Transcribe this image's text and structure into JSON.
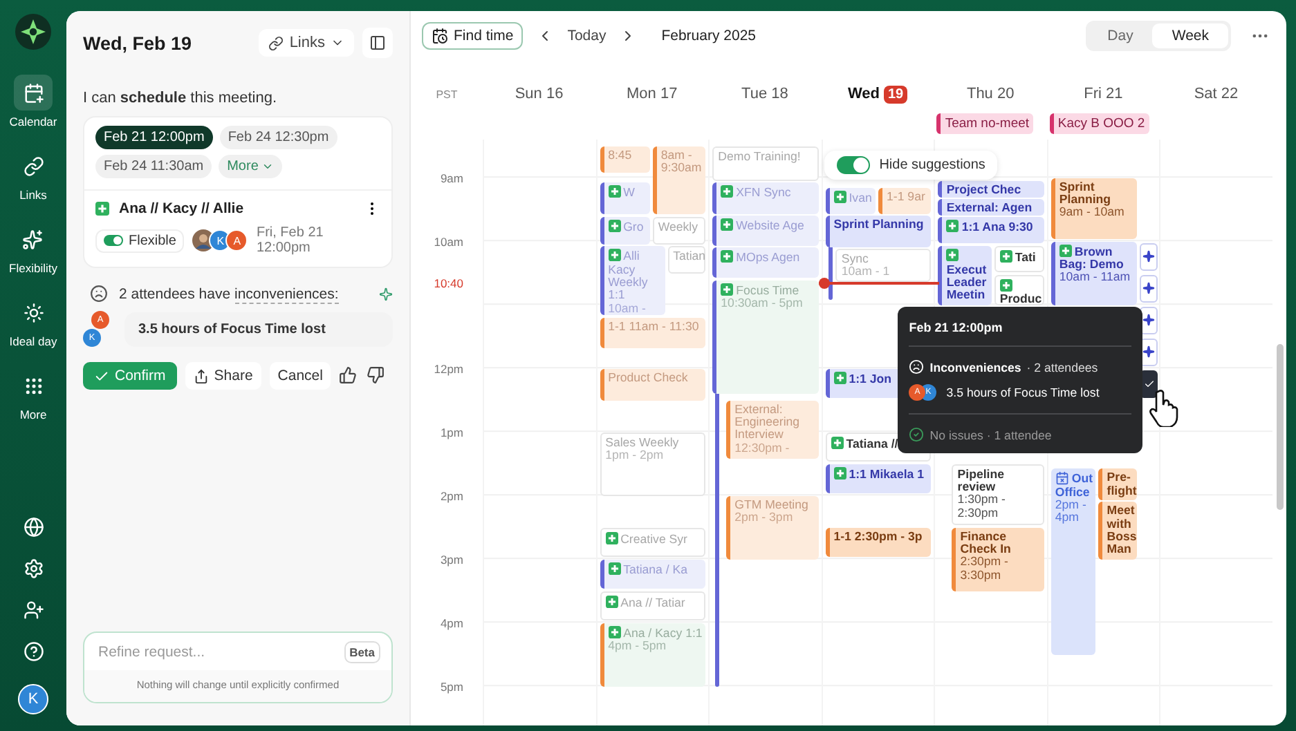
{
  "rail": {
    "items": [
      {
        "label": "Calendar",
        "selected": true
      },
      {
        "label": "Links",
        "selected": false
      },
      {
        "label": "Flexibility",
        "selected": false
      },
      {
        "label": "Ideal day",
        "selected": false
      },
      {
        "label": "More",
        "selected": false
      }
    ],
    "avatar": {
      "initial": "K",
      "color": "#2f86d6"
    }
  },
  "panel": {
    "title": "Wed, Feb 19",
    "links_button": "Links",
    "message": "I can **schedule** this meeting.",
    "slots": [
      {
        "label": "Feb 21 12:00pm",
        "selected": true
      },
      {
        "label": "Feb 24 12:30pm",
        "selected": false
      },
      {
        "label": "Feb 24 11:30am",
        "selected": false
      }
    ],
    "more": "More",
    "event": {
      "title": "Ana // Kacy // Allie",
      "flexible": {
        "label": "Flexible",
        "on": true
      },
      "attendees": [
        {
          "kind": "photo"
        },
        {
          "kind": "initial",
          "initial": "K",
          "color": "#2f86d6"
        },
        {
          "kind": "initial",
          "initial": "A",
          "color": "#e65a2b"
        }
      ],
      "when": "Fri, Feb 21 12:00pm"
    },
    "issue": {
      "summary": "2 attendees have",
      "term": "inconveniences:",
      "avatars": [
        {
          "initial": "A",
          "color": "#e65a2b"
        },
        {
          "initial": "K",
          "color": "#2f86d6"
        }
      ],
      "detail": "3.5 hours of Focus Time lost"
    },
    "actions": {
      "confirm": "Confirm",
      "share": "Share",
      "cancel": "Cancel"
    },
    "refine": {
      "placeholder": "Refine request...",
      "badge": "Beta",
      "note": "Nothing will change until explicitly confirmed"
    }
  },
  "toolbar": {
    "find_time": "Find time",
    "today": "Today",
    "month": "February 2025",
    "views": [
      {
        "label": "Day",
        "selected": false
      },
      {
        "label": "Week",
        "selected": true
      }
    ]
  },
  "calendar": {
    "timezone": "PST",
    "hours": [
      "9am",
      "10am",
      "12pm",
      "1pm",
      "2pm",
      "3pm",
      "4pm",
      "5pm"
    ],
    "now": "10:40",
    "hide_suggestions": {
      "label": "Hide suggestions",
      "on": true
    },
    "days": [
      {
        "name": "Sun",
        "date": "16",
        "today": false
      },
      {
        "name": "Mon",
        "date": "17",
        "today": false,
        "events": [
          {
            "title": "8:45",
            "kind": "filled",
            "color": "#f08a3c",
            "faded": true,
            "plus": false
          },
          {
            "title": "8am - 9:30am",
            "kind": "filled",
            "color": "#f08a3c",
            "faded": true,
            "plus": false
          },
          {
            "title": "W",
            "kind": "filled",
            "color": "#6466d6",
            "faded": true,
            "plus": true
          },
          {
            "title": "Gro",
            "kind": "filled",
            "color": "#6466d6",
            "faded": true,
            "plus": true
          },
          {
            "title": "Weekly",
            "kind": "outline",
            "faded": true,
            "plus": false
          },
          {
            "title": "Alli Kacy Weekly 1:1",
            "time": "10am -",
            "kind": "filled",
            "color": "#6466d6",
            "faded": true,
            "plus": true
          },
          {
            "title": "Tatian",
            "kind": "outline",
            "faded": true,
            "plus": false
          },
          {
            "title": "1-1 11am - 11:30",
            "kind": "filled",
            "color": "#f08a3c",
            "faded": true,
            "plus": false
          },
          {
            "title": "Product Check",
            "kind": "filled",
            "color": "#f08a3c",
            "faded": true,
            "plus": false
          },
          {
            "title": "Sales Weekly",
            "time": "1pm - 2pm",
            "kind": "outline",
            "faded": true,
            "plus": false
          },
          {
            "title": "Creative Syr",
            "kind": "outline",
            "faded": true,
            "plus": true
          },
          {
            "title": "Tatiana / Ka",
            "kind": "filled",
            "color": "#6466d6",
            "faded": true,
            "plus": true
          },
          {
            "title": "Ana // Tatiar",
            "kind": "outline",
            "faded": true,
            "plus": true
          },
          {
            "title": "Ana / Kacy 1:1",
            "time": "4pm - 5pm",
            "kind": "mint",
            "color": "#f08a3c",
            "faded": true,
            "plus": true
          }
        ]
      },
      {
        "name": "Tue",
        "date": "18",
        "today": false,
        "events": [
          {
            "title": "Demo Training!",
            "kind": "outline",
            "faded": true,
            "plus": false
          },
          {
            "title": "XFN Sync",
            "kind": "filled",
            "color": "#6466d6",
            "faded": true,
            "plus": true
          },
          {
            "title": "Website Age",
            "kind": "filled",
            "color": "#6466d6",
            "faded": true,
            "plus": true
          },
          {
            "title": "MOps Agen",
            "kind": "filled",
            "color": "#6466d6",
            "faded": true,
            "plus": true
          },
          {
            "title": "Focus Time",
            "time": "10:30am - 5pm",
            "kind": "mint",
            "color": "#6466d6",
            "faded": true,
            "plus": true
          },
          {
            "title": "External: Engineering Interview",
            "time": "12:30pm -",
            "kind": "filled",
            "color": "#f08a3c",
            "faded": true,
            "plus": false
          },
          {
            "title": "GTM Meeting",
            "time": "2pm - 3pm",
            "kind": "filled",
            "color": "#f08a3c",
            "faded": true,
            "plus": false
          }
        ]
      },
      {
        "name": "Wed",
        "date": "19",
        "today": true,
        "events": [
          {
            "title": "Ivan",
            "kind": "filled",
            "color": "#6466d6",
            "faded": true,
            "plus": true
          },
          {
            "title": "1-1 9ar",
            "kind": "filled",
            "color": "#f08a3c",
            "faded": true,
            "plus": false
          },
          {
            "title": "Sprint Planning",
            "kind": "filled",
            "color": "#6466d6",
            "faded": false,
            "plus": false
          },
          {
            "title": "Sync",
            "time": "10am - 1",
            "kind": "outline",
            "faded": true,
            "plus": false
          },
          {
            "title": "1:1 Jon",
            "kind": "filled",
            "color": "#6466d6",
            "faded": false,
            "plus": true
          },
          {
            "title": "Tatiana //",
            "kind": "outline",
            "faded": false,
            "plus": true
          },
          {
            "title": "1:1 Mikaela 1",
            "kind": "filled",
            "color": "#6466d6",
            "faded": false,
            "plus": true
          },
          {
            "title": "1-1 2:30pm - 3p",
            "kind": "filled",
            "color": "#f08a3c",
            "faded": false,
            "plus": false
          }
        ]
      },
      {
        "name": "Thu",
        "date": "20",
        "today": false,
        "all_day": [
          {
            "title": "Team no-meet",
            "color": "#d6336c"
          }
        ],
        "events": [
          {
            "title": "Project Chec",
            "kind": "filled",
            "color": "#6466d6",
            "faded": false,
            "plus": false
          },
          {
            "title": "External: Agen",
            "kind": "filled",
            "color": "#6466d6",
            "faded": false,
            "plus": false
          },
          {
            "title": "1:1 Ana 9:30",
            "kind": "filled",
            "color": "#6466d6",
            "faded": false,
            "plus": true
          },
          {
            "title": "Execut Leader Meetin",
            "kind": "filled",
            "color": "#6466d6",
            "faded": false,
            "plus": true
          },
          {
            "title": "Tati",
            "kind": "outline",
            "faded": false,
            "plus": true
          },
          {
            "title": "Produc",
            "kind": "outline",
            "faded": false,
            "plus": true
          },
          {
            "title": "Pipeline review",
            "time": "1:30pm - 2:30pm",
            "kind": "outline",
            "faded": false,
            "plus": false
          },
          {
            "title": "Finance Check In",
            "time": "2:30pm - 3:30pm",
            "kind": "filled",
            "color": "#f08a3c",
            "faded": false,
            "plus": false
          }
        ]
      },
      {
        "name": "Fri",
        "date": "21",
        "today": false,
        "all_day": [
          {
            "title": "Kacy B OOO 2",
            "color": "#d6336c"
          }
        ],
        "events": [
          {
            "title": "Sprint Planning",
            "time": "9am - 10am",
            "kind": "filled",
            "color": "#f08a3c",
            "faded": false,
            "plus": false
          },
          {
            "title": "Brown Bag: Demo",
            "time": "10am - 11am",
            "kind": "filled",
            "color": "#6466d6",
            "faded": false,
            "plus": true
          },
          {
            "title": "Out Office",
            "time": "2pm - 4pm",
            "kind": "away",
            "color": "#3f63d8",
            "faded": false,
            "plus": false
          },
          {
            "title": "Pre-flight",
            "kind": "filled",
            "color": "#f08a3c",
            "faded": false,
            "plus": false
          },
          {
            "title": "Meet with Boss Man",
            "kind": "filled",
            "color": "#f08a3c",
            "faded": false,
            "plus": false
          }
        ],
        "suggestions": [
          {
            "kind": "sparkle",
            "selected": false
          },
          {
            "kind": "sparkle",
            "selected": false
          },
          {
            "kind": "sparkle",
            "selected": false
          },
          {
            "kind": "sparkle",
            "selected": false
          },
          {
            "kind": "check",
            "selected": true
          }
        ]
      },
      {
        "name": "Sat",
        "date": "22",
        "today": false
      }
    ]
  },
  "popup": {
    "title": "Feb 21 12:00pm",
    "issue_label": "Inconveniences",
    "issue_count": "· 2 attendees",
    "avatars": [
      {
        "initial": "A",
        "color": "#e65a2b"
      },
      {
        "initial": "K",
        "color": "#2f86d6"
      }
    ],
    "issue_detail": "3.5 hours of Focus Time lost",
    "ok": "No issues · 1 attendee"
  }
}
